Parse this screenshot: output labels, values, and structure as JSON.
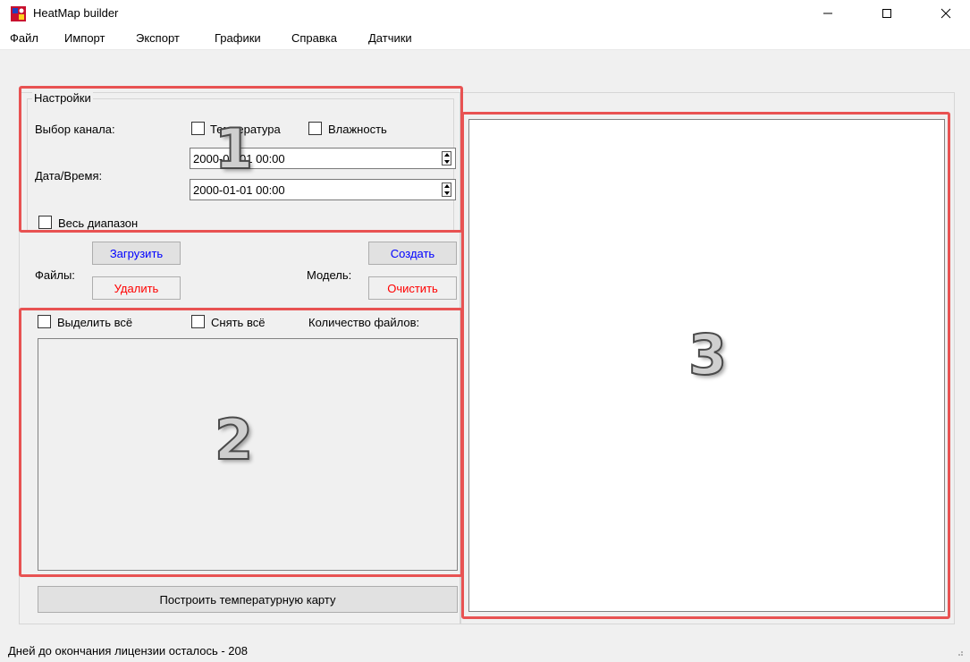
{
  "window": {
    "title": "HeatMap builder",
    "controls": {
      "minimize": "—",
      "maximize": "☐",
      "close": "✕"
    }
  },
  "menu": [
    "Файл",
    "Импорт",
    "Экспорт",
    "Графики",
    "Справка",
    "Датчики"
  ],
  "settings": {
    "group_title": "Настройки",
    "channel_label": "Выбор канала:",
    "temperature_label": "Температура",
    "humidity_label": "Влажность",
    "datetime_label": "Дата/Время:",
    "datetime_from": "2000-01-01 00:00",
    "datetime_to": "2000-01-01 00:00",
    "full_range_label": "Весь диапазон"
  },
  "files": {
    "label": "Файлы:",
    "load_button": "Загрузить",
    "delete_button": "Удалить"
  },
  "model": {
    "label": "Модель:",
    "create_button": "Создать",
    "clear_button": "Очистить"
  },
  "file_list": {
    "select_all_label": "Выделить всё",
    "deselect_all_label": "Снять всё",
    "count_label": "Количество файлов:"
  },
  "build_button": "Построить температурную карту",
  "status_bar": "Дней до окончания лицензии осталось - 208",
  "annotations": {
    "one": "1",
    "two": "2",
    "three": "3"
  },
  "colors": {
    "accent_blue": "#0000ff",
    "accent_red": "#ff0000",
    "annotation_frame": "#e85252"
  }
}
